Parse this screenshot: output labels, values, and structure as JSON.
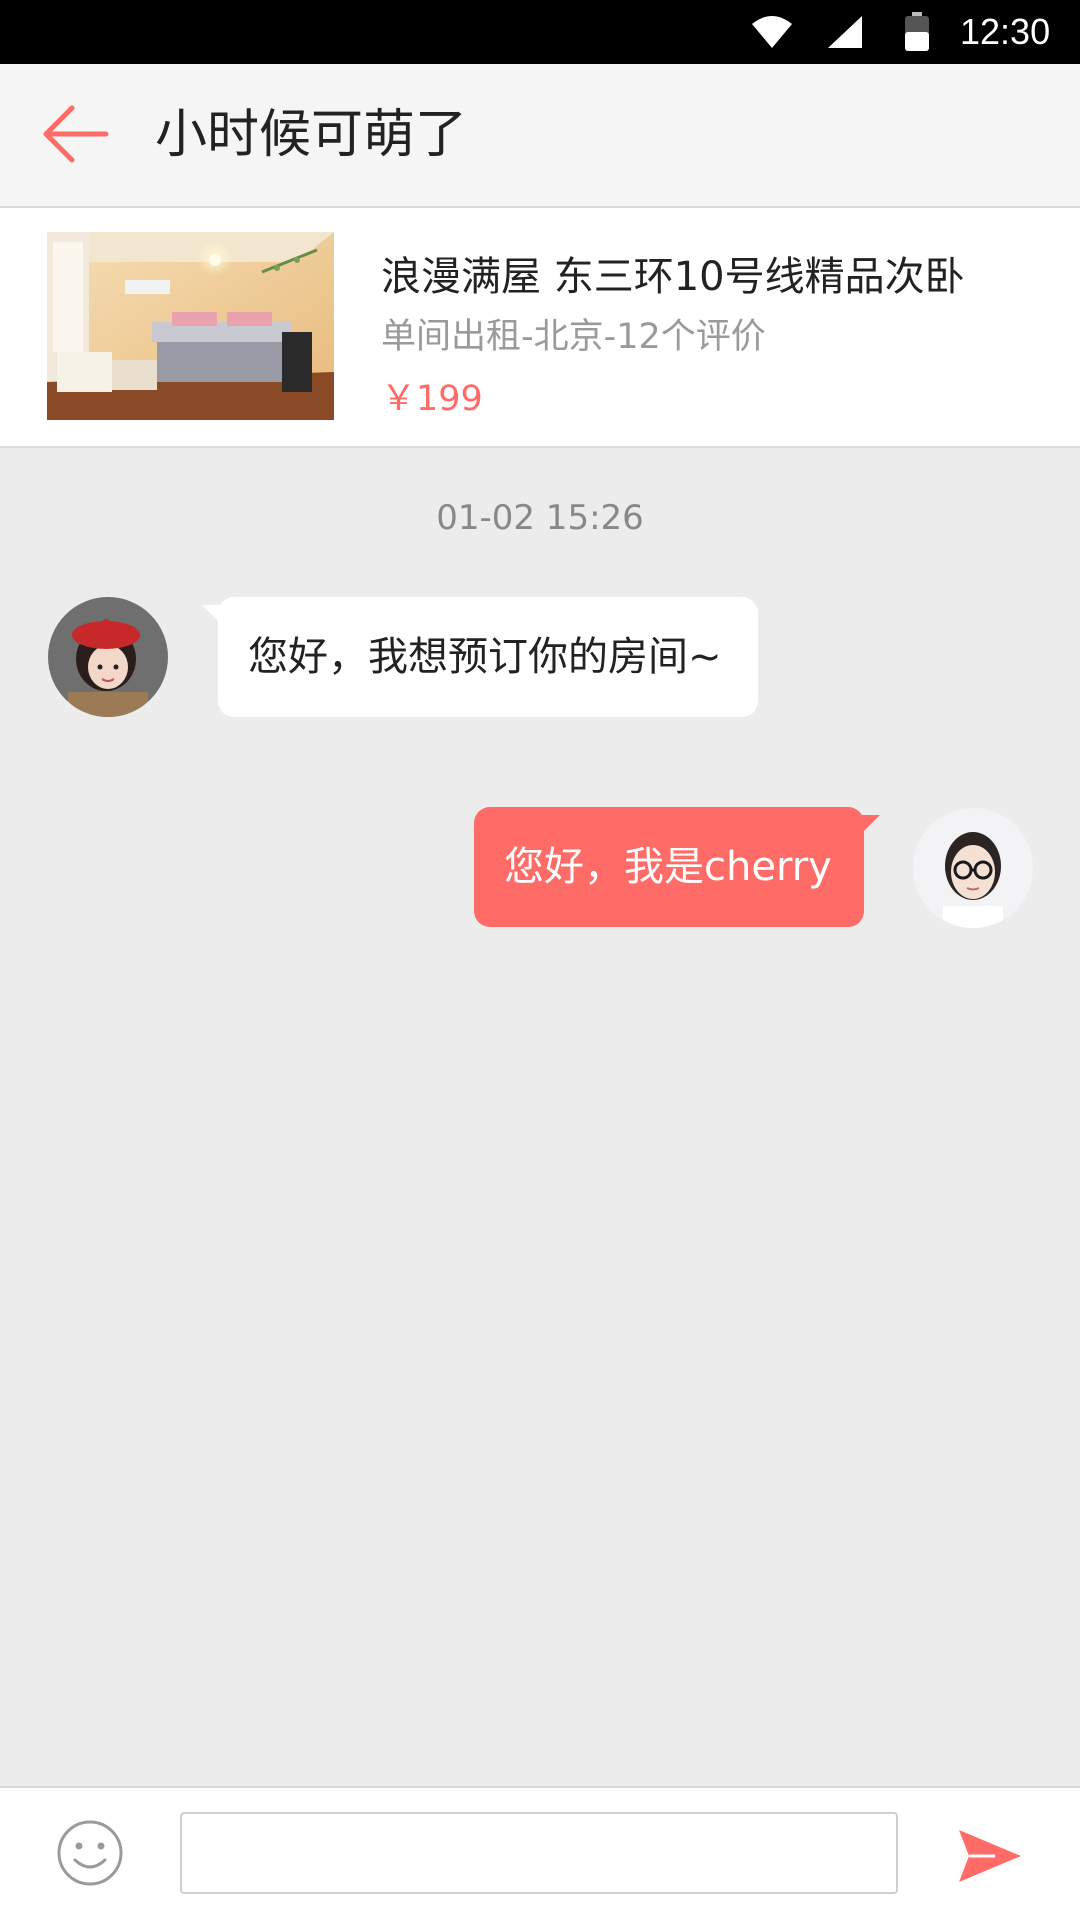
{
  "status_bar": {
    "time": "12:30",
    "icons": [
      "wifi-icon",
      "signal-icon",
      "battery-icon"
    ]
  },
  "header": {
    "title": "小时候可萌了",
    "back_icon": "arrow-left-icon"
  },
  "listing": {
    "title": "浪漫满屋 东三环10号线精品次卧",
    "subtitle": "单间出租-北京-12个评价",
    "price": "￥199"
  },
  "chat": {
    "timestamp": "01-02 15:26",
    "messages": [
      {
        "from": "other",
        "text": "您好，我想预订你的房间~"
      },
      {
        "from": "me",
        "text": "您好，我是cherry"
      }
    ]
  },
  "input": {
    "value": "",
    "placeholder": "",
    "emoji_icon": "smiley-icon",
    "send_icon": "send-icon"
  },
  "colors": {
    "accent": "#ff6b66",
    "background": "#ececec",
    "header_bg": "#f5f5f5"
  }
}
